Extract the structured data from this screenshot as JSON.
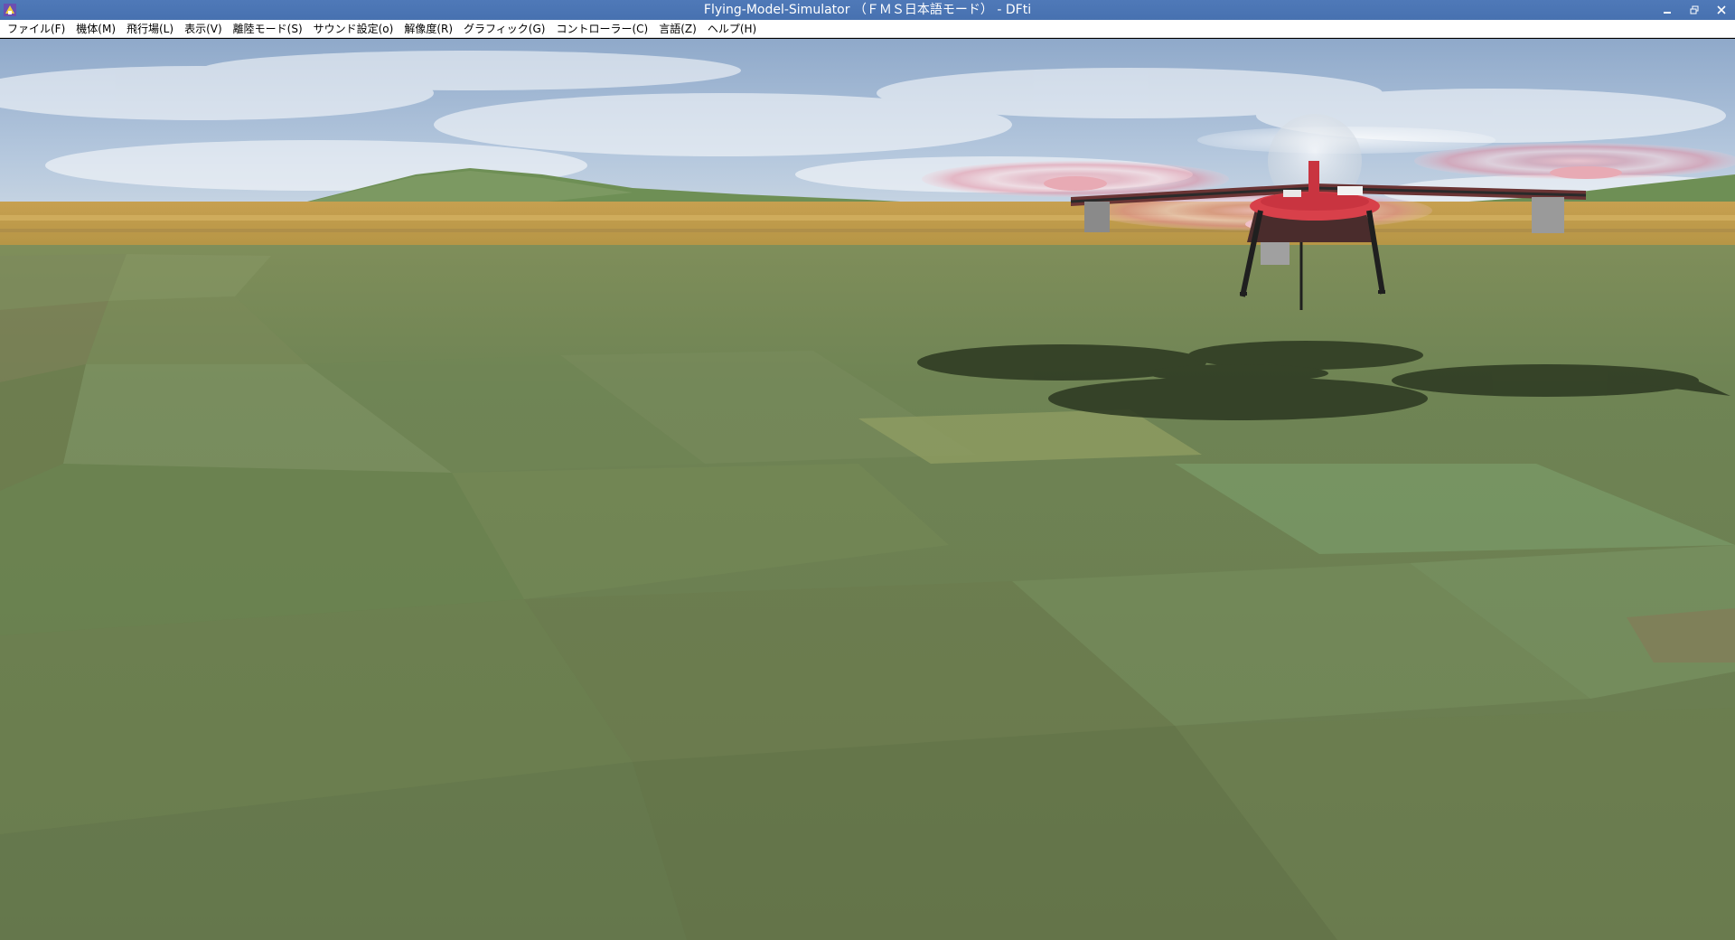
{
  "window": {
    "title": "Flying-Model-Simulator （ＦＭＳ日本語モード） - DFti"
  },
  "menubar": {
    "items": [
      {
        "label": "ファイル(F)"
      },
      {
        "label": "機体(M)"
      },
      {
        "label": "飛行場(L)"
      },
      {
        "label": "表示(V)"
      },
      {
        "label": "離陸モード(S)"
      },
      {
        "label": "サウンド設定(o)"
      },
      {
        "label": "解像度(R)"
      },
      {
        "label": "グラフィック(G)"
      },
      {
        "label": "コントローラー(C)"
      },
      {
        "label": "言語(Z)"
      },
      {
        "label": "ヘルプ(H)"
      }
    ]
  },
  "scene": {
    "model": "quadcopter",
    "sky_color": "#9fb8d6",
    "ground_color": "#6f8456",
    "horizon_color": "#c9a24f",
    "accent_color": "#d8404a"
  }
}
